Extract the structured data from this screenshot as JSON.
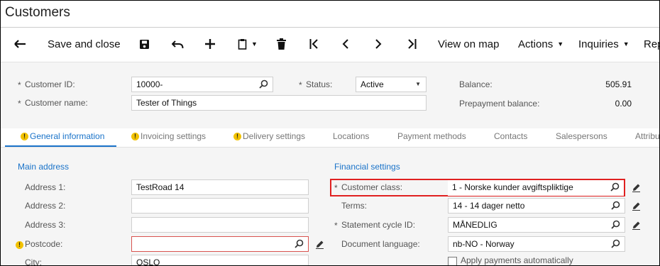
{
  "page": {
    "title": "Customers"
  },
  "toolbar": {
    "save_close": "Save and close",
    "view_on_map": "View on map",
    "actions": "Actions",
    "inquiries": "Inquiries",
    "reports_cut": "Rep"
  },
  "summary": {
    "customer_id": {
      "label": "Customer ID:",
      "value": "10000-"
    },
    "customer_name": {
      "label": "Customer name:",
      "value": "Tester of Things"
    },
    "status": {
      "label": "Status:",
      "value": "Active"
    },
    "balance": {
      "label": "Balance:",
      "value": "505.91"
    },
    "prepayment": {
      "label": "Prepayment balance:",
      "value": "0.00"
    }
  },
  "tabs": [
    {
      "label": "General information",
      "warning": true
    },
    {
      "label": "Invoicing settings",
      "warning": true
    },
    {
      "label": "Delivery settings",
      "warning": true
    },
    {
      "label": "Locations"
    },
    {
      "label": "Payment methods"
    },
    {
      "label": "Contacts"
    },
    {
      "label": "Salespersons"
    },
    {
      "label": "Attribu"
    }
  ],
  "main_address": {
    "heading": "Main address",
    "address1": {
      "label": "Address 1:",
      "value": "TestRoad 14"
    },
    "address2": {
      "label": "Address 2:",
      "value": ""
    },
    "address3": {
      "label": "Address 3:",
      "value": ""
    },
    "postcode": {
      "label": "Postcode:",
      "value": ""
    },
    "city": {
      "label": "City:",
      "value": "OSLO"
    }
  },
  "financial": {
    "heading": "Financial settings",
    "customer_class": {
      "label": "Customer class:",
      "value": "1 - Norske kunder avgiftspliktige"
    },
    "terms": {
      "label": "Terms:",
      "value": "14 - 14 dager netto"
    },
    "statement_cycle": {
      "label": "Statement cycle ID:",
      "value": "MÅNEDLIG"
    },
    "document_language": {
      "label": "Document language:",
      "value": "nb-NO - Norway"
    },
    "apply_payments": "Apply payments automatically"
  },
  "colors": {
    "accent": "#1a73c9",
    "highlight": "#e02020",
    "warning": "#f2c200",
    "panel": "#f5f5f5"
  }
}
